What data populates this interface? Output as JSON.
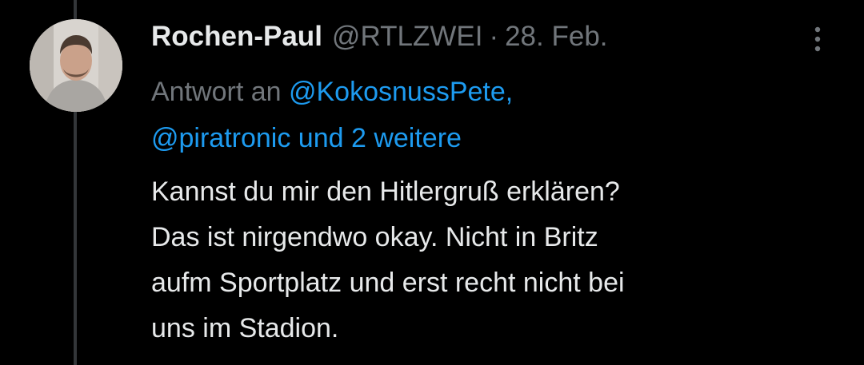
{
  "tweet": {
    "display_name": "Rochen-Paul",
    "handle": "@RTLZWEI",
    "separator": "·",
    "date": "28. Feb.",
    "reply_prefix": "Antwort an",
    "reply_mention_1": "@KokosnussPete,",
    "reply_mention_2": "@piratronic und 2 weitere",
    "text_lines": [
      "Kannst du mir den Hitlergruß erklären?",
      "Das ist nirgendwo okay. Nicht in Britz",
      "aufm Sportplatz und erst recht nicht bei",
      "uns im Stadion."
    ]
  },
  "icons": {
    "more": "more-vertical-icon",
    "avatar": "user-avatar"
  },
  "colors": {
    "background": "#000000",
    "text_primary": "#e7e9ea",
    "text_secondary": "#71767b",
    "link": "#1d9bf0",
    "thread_line": "#333639"
  }
}
